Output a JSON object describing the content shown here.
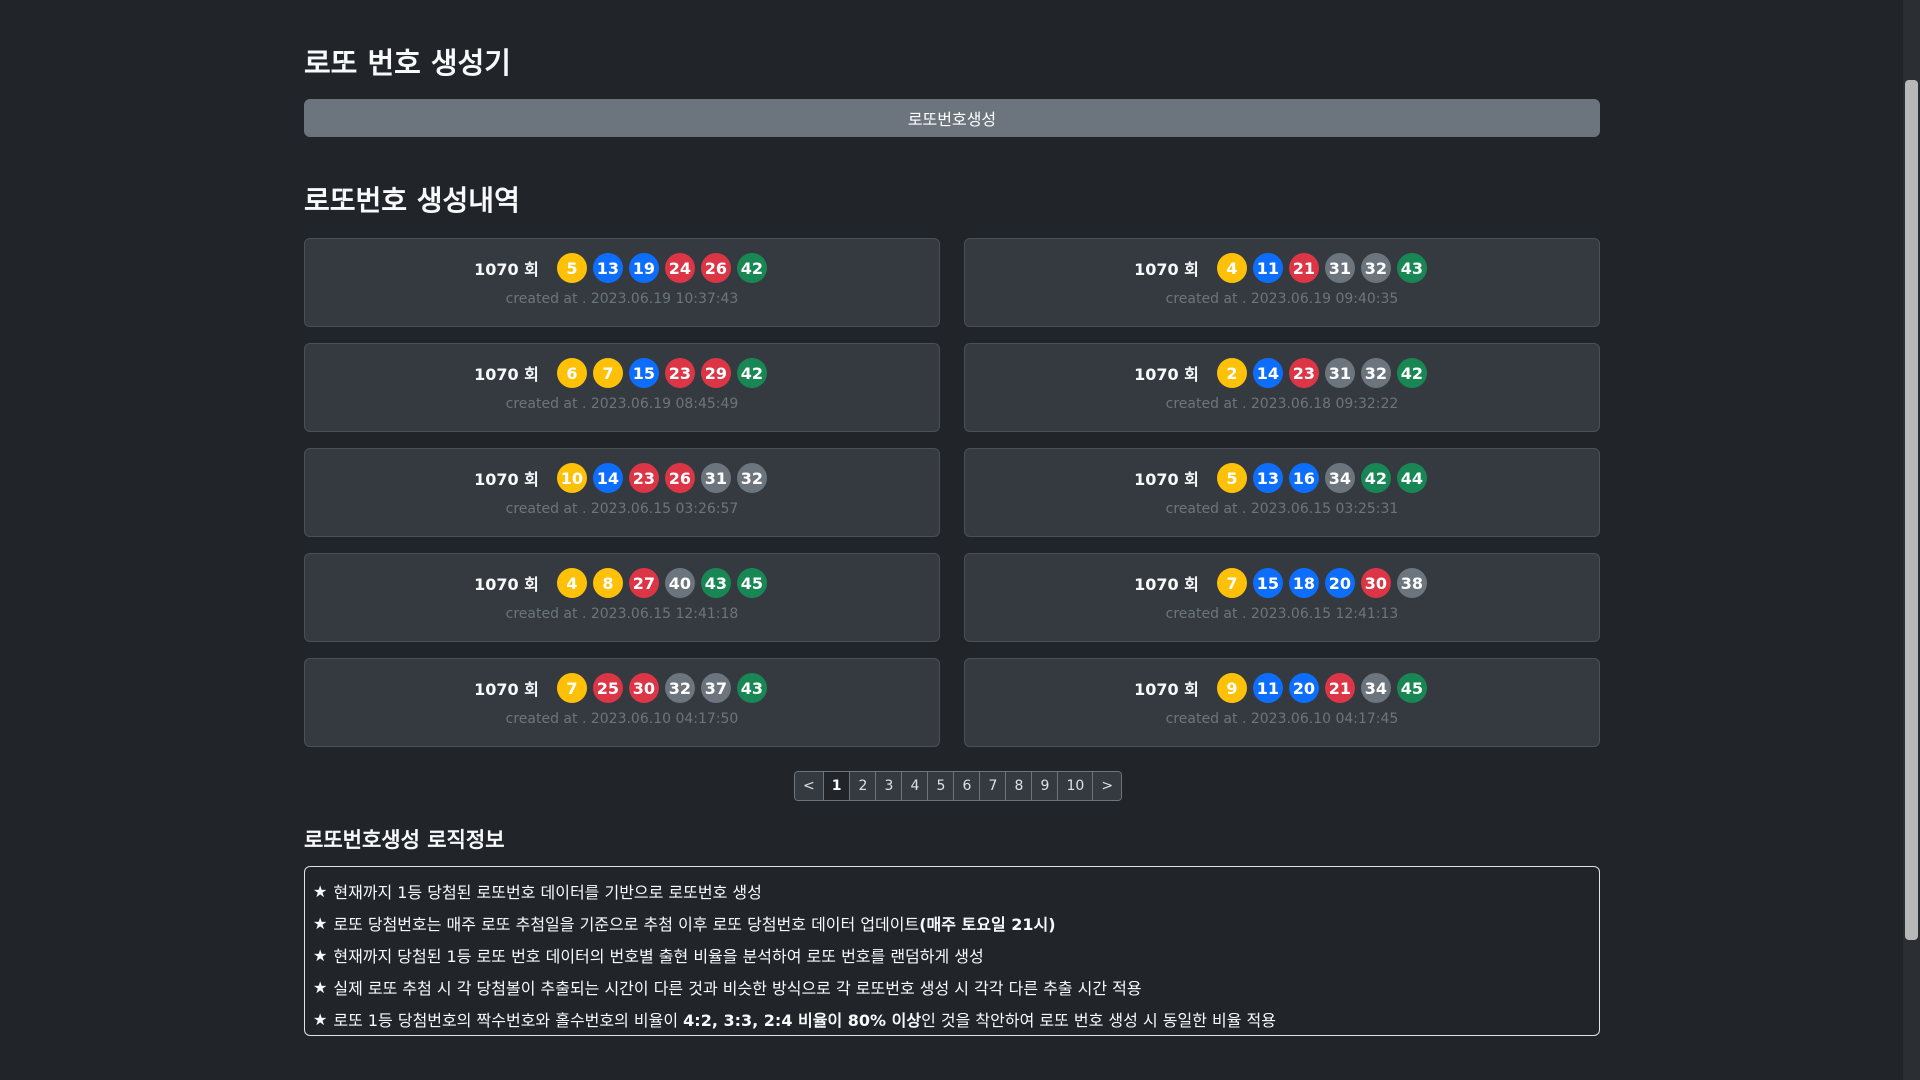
{
  "header": {
    "title": "로또 번호 생성기",
    "generate_label": "로또번호생성"
  },
  "history": {
    "title": "로또번호 생성내역",
    "created_prefix": "created at . ",
    "round_suffix": " 회",
    "items": [
      {
        "round": "1070",
        "numbers": [
          5,
          13,
          19,
          24,
          26,
          42
        ],
        "created": "2023.06.19 10:37:43"
      },
      {
        "round": "1070",
        "numbers": [
          4,
          11,
          21,
          31,
          32,
          43
        ],
        "created": "2023.06.19 09:40:35"
      },
      {
        "round": "1070",
        "numbers": [
          6,
          7,
          15,
          23,
          29,
          42
        ],
        "created": "2023.06.19 08:45:49"
      },
      {
        "round": "1070",
        "numbers": [
          2,
          14,
          23,
          31,
          32,
          42
        ],
        "created": "2023.06.18 09:32:22"
      },
      {
        "round": "1070",
        "numbers": [
          10,
          14,
          23,
          26,
          31,
          32
        ],
        "created": "2023.06.15 03:26:57"
      },
      {
        "round": "1070",
        "numbers": [
          5,
          13,
          16,
          34,
          42,
          44
        ],
        "created": "2023.06.15 03:25:31"
      },
      {
        "round": "1070",
        "numbers": [
          4,
          8,
          27,
          40,
          43,
          45
        ],
        "created": "2023.06.15 12:41:18"
      },
      {
        "round": "1070",
        "numbers": [
          7,
          15,
          18,
          20,
          30,
          38
        ],
        "created": "2023.06.15 12:41:13"
      },
      {
        "round": "1070",
        "numbers": [
          7,
          25,
          30,
          32,
          37,
          43
        ],
        "created": "2023.06.10 04:17:50"
      },
      {
        "round": "1070",
        "numbers": [
          9,
          11,
          20,
          21,
          34,
          45
        ],
        "created": "2023.06.10 04:17:45"
      }
    ]
  },
  "ball_colors": {
    "1-10": "#ffc107",
    "11-20": "#0d6efd",
    "21-30": "#dc3545",
    "31-40": "#6c757d",
    "41-45": "#198754"
  },
  "pagination": {
    "prev": "<",
    "next": ">",
    "pages": [
      "1",
      "2",
      "3",
      "4",
      "5",
      "6",
      "7",
      "8",
      "9",
      "10"
    ],
    "current": "1"
  },
  "logic": {
    "title": "로또번호생성 로직정보",
    "star": "★",
    "items": [
      {
        "text": "현재까지 1등 당첨된 로또번호 데이터를 기반으로 로또번호 생성",
        "bold": "",
        "after": ""
      },
      {
        "text": "로또 당첨번호는 매주 로또 추첨일을 기준으로 추첨 이후 로또 당첨번호 데이터 업데이트",
        "bold": "(매주 토요일 21시)",
        "after": ""
      },
      {
        "text": "현재까지 당첨된 1등 로또 번호 데이터의 번호별 출현 비율을 분석하여 로또 번호를 랜덤하게 생성",
        "bold": "",
        "after": ""
      },
      {
        "text": "실제 로또 추첨 시 각 당첨볼이 추출되는 시간이 다른 것과 비슷한 방식으로 각 로또번호 생성 시 각각 다른 추출 시간 적용",
        "bold": "",
        "after": ""
      },
      {
        "text": "로또 1등 당첨번호의 짝수번호와 홀수번호의 비율이 ",
        "bold": "4:2, 3:3, 2:4 비율이 80% 이상",
        "after": "인 것을 착안하여 로또 번호 생성 시 동일한 비율 적용"
      }
    ]
  }
}
